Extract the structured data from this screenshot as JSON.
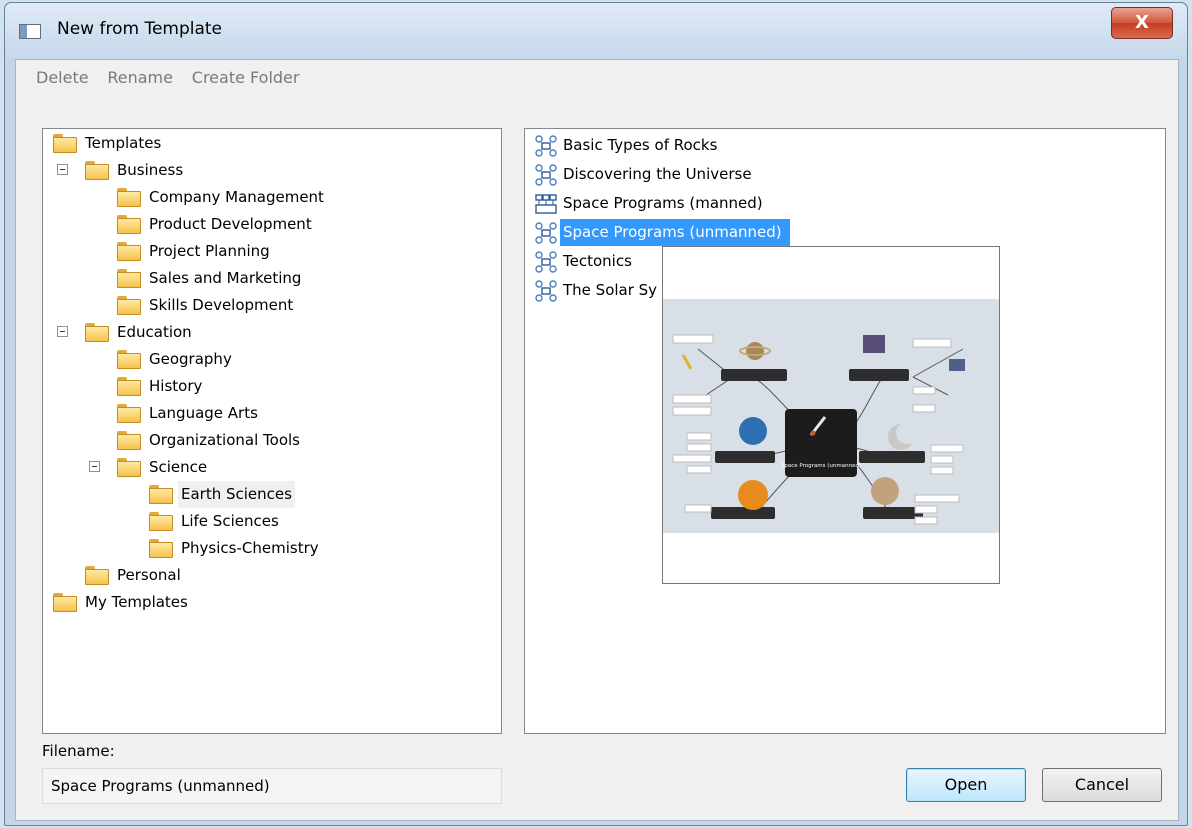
{
  "window": {
    "title": "New from Template",
    "close_glyph": "X"
  },
  "toolbar": {
    "items": [
      "Delete",
      "Rename",
      "Create Folder"
    ]
  },
  "tree": {
    "items": [
      {
        "label": "Templates"
      },
      {
        "label": "Business"
      },
      {
        "label": "Company Management"
      },
      {
        "label": "Product Development"
      },
      {
        "label": "Project Planning"
      },
      {
        "label": "Sales and Marketing"
      },
      {
        "label": "Skills Development"
      },
      {
        "label": "Education"
      },
      {
        "label": "Geography"
      },
      {
        "label": "History"
      },
      {
        "label": "Language Arts"
      },
      {
        "label": "Organizational Tools"
      },
      {
        "label": "Science"
      },
      {
        "label": "Earth Sciences"
      },
      {
        "label": "Life Sciences"
      },
      {
        "label": "Physics-Chemistry"
      },
      {
        "label": "Personal"
      },
      {
        "label": "My Templates"
      }
    ]
  },
  "list": {
    "items": [
      {
        "label": "Basic Types of Rocks",
        "icon": "mind-map-icon"
      },
      {
        "label": "Discovering the Universe",
        "icon": "mind-map-icon"
      },
      {
        "label": "Space Programs (manned)",
        "icon": "org-chart-icon"
      },
      {
        "label": "Space Programs (unmanned)",
        "icon": "mind-map-icon",
        "selected": true
      },
      {
        "label": "Tectonics",
        "icon": "mind-map-icon"
      },
      {
        "label": "The Solar Sy",
        "icon": "mind-map-icon"
      }
    ],
    "preview": {
      "central_topic": "Space Programs (unmanned)"
    }
  },
  "filename": {
    "label": "Filename:",
    "value": "Space Programs (unmanned)"
  },
  "buttons": {
    "open": "Open",
    "cancel": "Cancel"
  },
  "colors": {
    "selection": "#3399ff",
    "folder": "#f5c24c",
    "close_button": "#c43d22"
  }
}
